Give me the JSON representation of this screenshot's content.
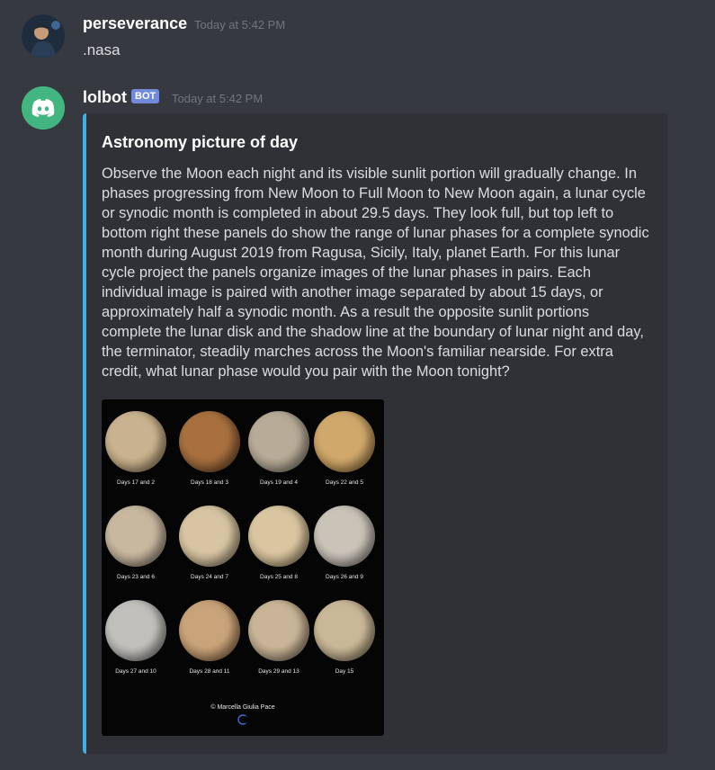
{
  "messages": [
    {
      "username": "perseverance",
      "timestamp": "Today at 5:42 PM",
      "content": ".nasa"
    },
    {
      "username": "lolbot",
      "bot_tag": "BOT",
      "timestamp": "Today at 5:42 PM",
      "embed": {
        "title": "Astronomy picture of day",
        "description": "Observe the Moon each night and its visible sunlit portion will gradually change. In phases progressing from New Moon to Full Moon to New Moon again, a lunar cycle or synodic month is completed in about 29.5 days. They look full, but top left to bottom right these panels do show the range of lunar phases for a complete synodic month during August 2019 from Ragusa, Sicily, Italy, planet Earth. For this lunar cycle project the panels organize images of the lunar phases in pairs. Each individual image is paired with another image separated by about 15 days, or approximately half a synodic month. As a result the opposite sunlit portions complete the lunar disk and the shadow line at the boundary of lunar night and day, the terminator, steadily marches across the Moon's familiar nearside. For extra credit, what lunar phase would you pair with the Moon tonight?",
        "accent_color": "#3fb0e6",
        "image": {
          "panels": [
            "Days 17 and 2",
            "Days 18 and 3",
            "Days 19 and 4",
            "Days 22 and 5",
            "Days 23 and 6",
            "Days 24 and 7",
            "Days 25 and 8",
            "Days 26 and 9",
            "Days 27 and 10",
            "Days 28 and 11",
            "Days 29 and 13",
            "Day 15"
          ],
          "credit": "© Marcella Giulia Pace"
        }
      }
    }
  ],
  "colors": {
    "background": "#36393f",
    "embed_background": "#2f3136",
    "bot_tag": "#7289da",
    "discord_avatar": "#43b581"
  }
}
